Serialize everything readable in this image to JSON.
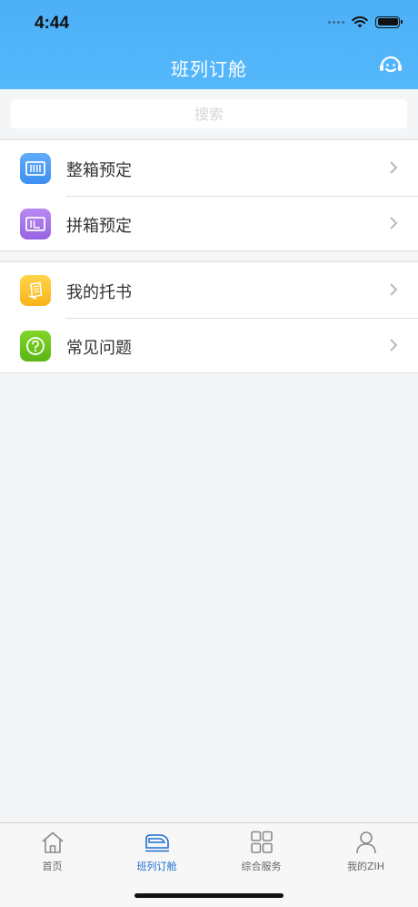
{
  "status_bar": {
    "time": "4:44"
  },
  "nav": {
    "title": "班列订舱",
    "support_icon": "customer-service-icon"
  },
  "search": {
    "placeholder": "搜索"
  },
  "groups": [
    {
      "items": [
        {
          "label": "整箱预定",
          "icon": "container-icon",
          "icon_color": "#4a9cf6"
        },
        {
          "label": "拼箱预定",
          "icon": "partial-container-icon",
          "icon_color": "#a575e8"
        }
      ]
    },
    {
      "items": [
        {
          "label": "我的托书",
          "icon": "document-icon",
          "icon_color": "#fbc02d"
        },
        {
          "label": "常见问题",
          "icon": "question-icon",
          "icon_color": "#6cc61e"
        }
      ]
    }
  ],
  "tabbar": {
    "active": 1,
    "tabs": [
      {
        "label": "首页",
        "icon": "home-icon"
      },
      {
        "label": "班列订舱",
        "icon": "train-icon"
      },
      {
        "label": "综合服务",
        "icon": "grid-icon"
      },
      {
        "label": "我的ZIH",
        "icon": "user-icon"
      }
    ]
  },
  "colors": {
    "header": "#4db0f7",
    "accent": "#1b6fd0",
    "background": "#f4f5f7"
  }
}
